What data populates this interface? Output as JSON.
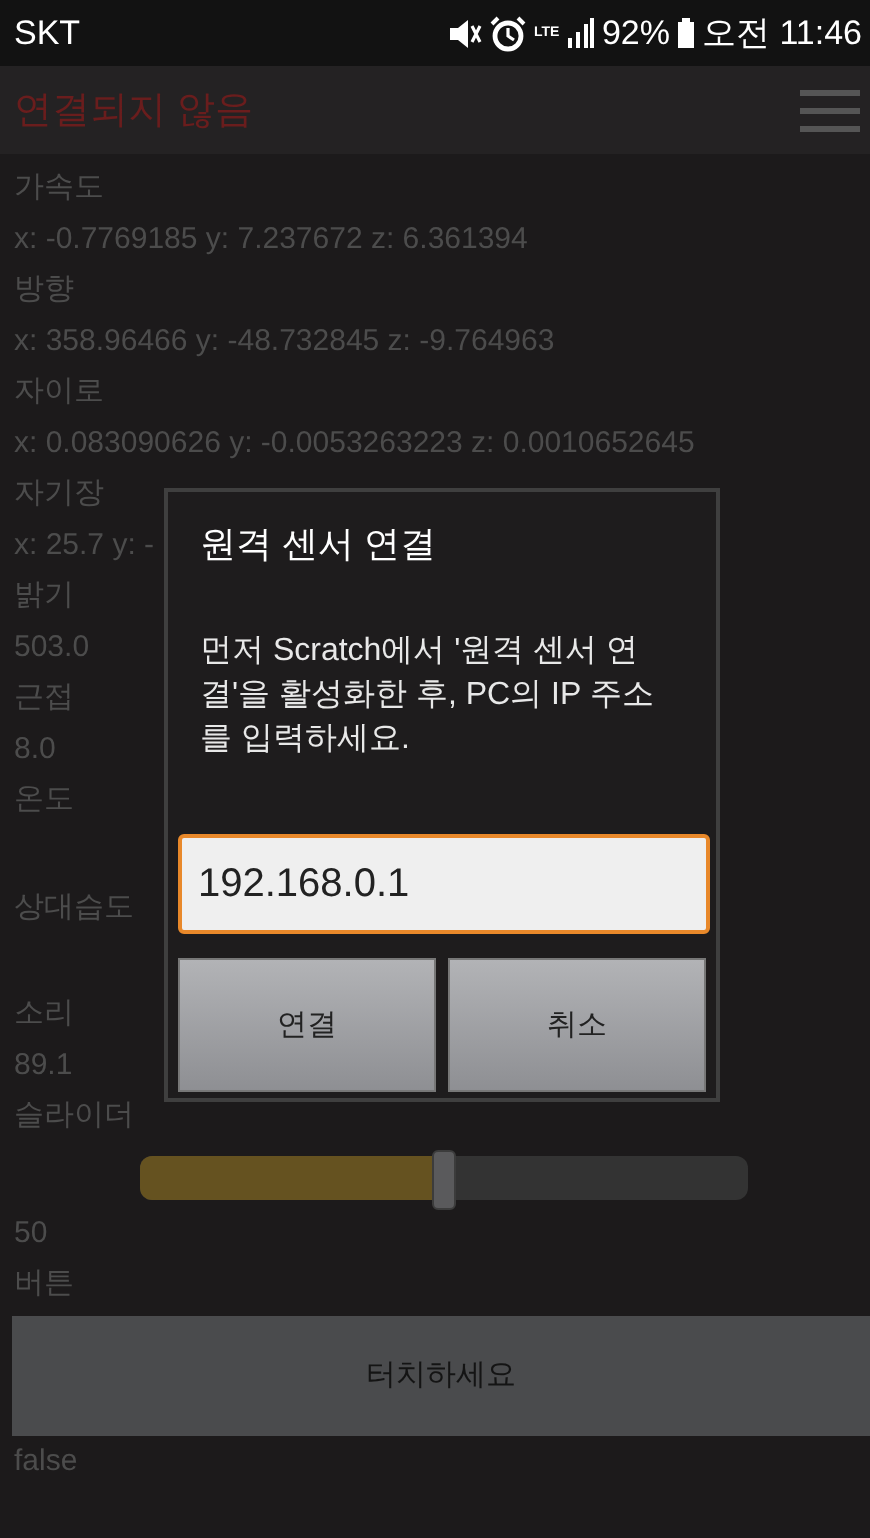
{
  "status_bar": {
    "carrier": "SKT",
    "network": "LTE",
    "battery": "92%",
    "time": "오전 11:46"
  },
  "app_bar": {
    "title": "연결되지 않음",
    "connected": false
  },
  "rows": [
    {
      "kind": "text",
      "label": "가속도",
      "value": "x: -0.7769185 y: 7.237672 z: 6.361394"
    },
    {
      "kind": "text",
      "label": "방향",
      "value": "x: 358.96466 y: -48.732845 z: -9.764963"
    },
    {
      "kind": "text",
      "label": "자이로",
      "value": "x: 0.083090626 y: -0.0053263223 z: 0.0010652645"
    },
    {
      "kind": "text",
      "label": "자기장",
      "value": "x: 25.7 y: -"
    },
    {
      "kind": "text",
      "label": "밝기",
      "value": "503.0"
    },
    {
      "kind": "text",
      "label": "근접",
      "value": "8.0"
    },
    {
      "kind": "text",
      "label": "온도"
    },
    {
      "kind": "text",
      "label": "상대습도"
    },
    {
      "kind": "text",
      "label": "소리",
      "value": "89.1"
    },
    {
      "kind": "slider",
      "label": "슬라이더",
      "level": 0.5,
      "reading": "50"
    },
    {
      "kind": "button",
      "label": "버튼",
      "button": "터치하세요",
      "reading": "false"
    }
  ],
  "dialog": {
    "title": "원격 센서 연결",
    "message": "먼저 Scratch에서 '원격 센서 연결'을 활성화한 후, PC의 IP 주소를 입력하세요.",
    "input": {
      "value": "192.168.0.1",
      "focused": true
    },
    "buttons": [
      "연결",
      "취소"
    ]
  }
}
